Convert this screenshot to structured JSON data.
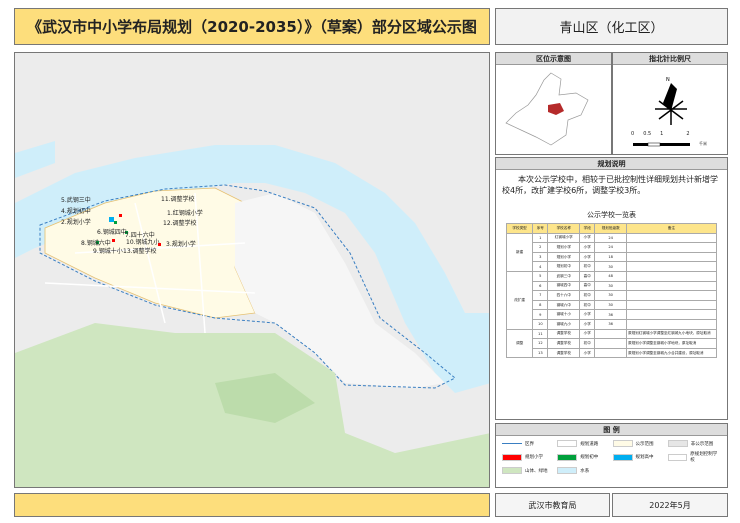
{
  "title": "《武汉市中小学布局规划（2020-2035）》（草案）部分区域公示图",
  "district": "青山区（化工区）",
  "location_map": {
    "header": "区位示意图"
  },
  "compass": {
    "header": "指北针比例尺",
    "north": "N",
    "scale_ticks": [
      "0",
      "0.5",
      "1",
      "2"
    ],
    "scale_unit": "千米"
  },
  "plan": {
    "header": "规划说明",
    "text": "本次公示学校中，相较于已批控制性详细规划共计新增学校4所，改扩建学校6所，调整学校3所。"
  },
  "table": {
    "title": "公示学校一览表",
    "headers": [
      "学校类型",
      "序号",
      "学校名称",
      "学段",
      "规划班级数",
      "备注"
    ],
    "groups": [
      {
        "type": "新建",
        "rows": [
          [
            "1",
            "红钢城小学",
            "小学",
            "24",
            ""
          ],
          [
            "2",
            "规划小学",
            "小学",
            "24",
            ""
          ],
          [
            "3",
            "规划小学",
            "小学",
            "18",
            ""
          ],
          [
            "4",
            "规划初中",
            "初中",
            "30",
            ""
          ]
        ]
      },
      {
        "type": "改扩建",
        "rows": [
          [
            "5",
            "武钢三中",
            "高中",
            "48",
            ""
          ],
          [
            "6",
            "钢城四中",
            "高中",
            "30",
            ""
          ],
          [
            "7",
            "四十六中",
            "初中",
            "30",
            ""
          ],
          [
            "8",
            "钢城六中",
            "初中",
            "30",
            ""
          ],
          [
            "9",
            "钢城十小",
            "小学",
            "36",
            ""
          ],
          [
            "10",
            "钢城九小",
            "小学",
            "36",
            ""
          ]
        ]
      },
      {
        "type": "调整",
        "rows": [
          [
            "11",
            "调整学校",
            "小学",
            "",
            "原规划红钢城小学调整至红钢城九小地块，原址取消"
          ],
          [
            "12",
            "调整学校",
            "初中",
            "",
            "原规划小学调整至钢城小学地块，原址取消"
          ],
          [
            "13",
            "调整学校",
            "小学",
            "",
            "原规划小学调整至钢城九小合并建设，原址取消"
          ]
        ]
      }
    ]
  },
  "legend": {
    "header": "图  例",
    "items": [
      {
        "label": "区界",
        "color": "#3a7fc2"
      },
      {
        "label": "规划道路",
        "color": "#ffffff"
      },
      {
        "label": "公示范围",
        "color": "#fffbe6"
      },
      {
        "label": "非公示范围",
        "color": "#e6e6e6"
      },
      {
        "label": "规划小学",
        "color": "#ff0000"
      },
      {
        "label": "规划初中",
        "color": "#00a03c"
      },
      {
        "label": "规划高中",
        "color": "#00aeef"
      },
      {
        "label": "原规划控制学校",
        "color": "#ffffff"
      },
      {
        "label": "山体、绿地",
        "color": "#cfe6c0"
      },
      {
        "label": "水系",
        "color": "#cfeefa"
      }
    ]
  },
  "map_labels": [
    "5.武钢三中",
    "4.规划初中",
    "2.规划小学",
    "11.调整学校",
    "1.红钢城小学",
    "12.调整学校",
    "6.钢城四中",
    "7.四十六中",
    "8.钢城六中",
    "10.钢城九小",
    "3.规划小学",
    "9.钢城十小",
    "13.调整学校"
  ],
  "footer": {
    "org": "武汉市教育局",
    "date": "2022年5月"
  }
}
